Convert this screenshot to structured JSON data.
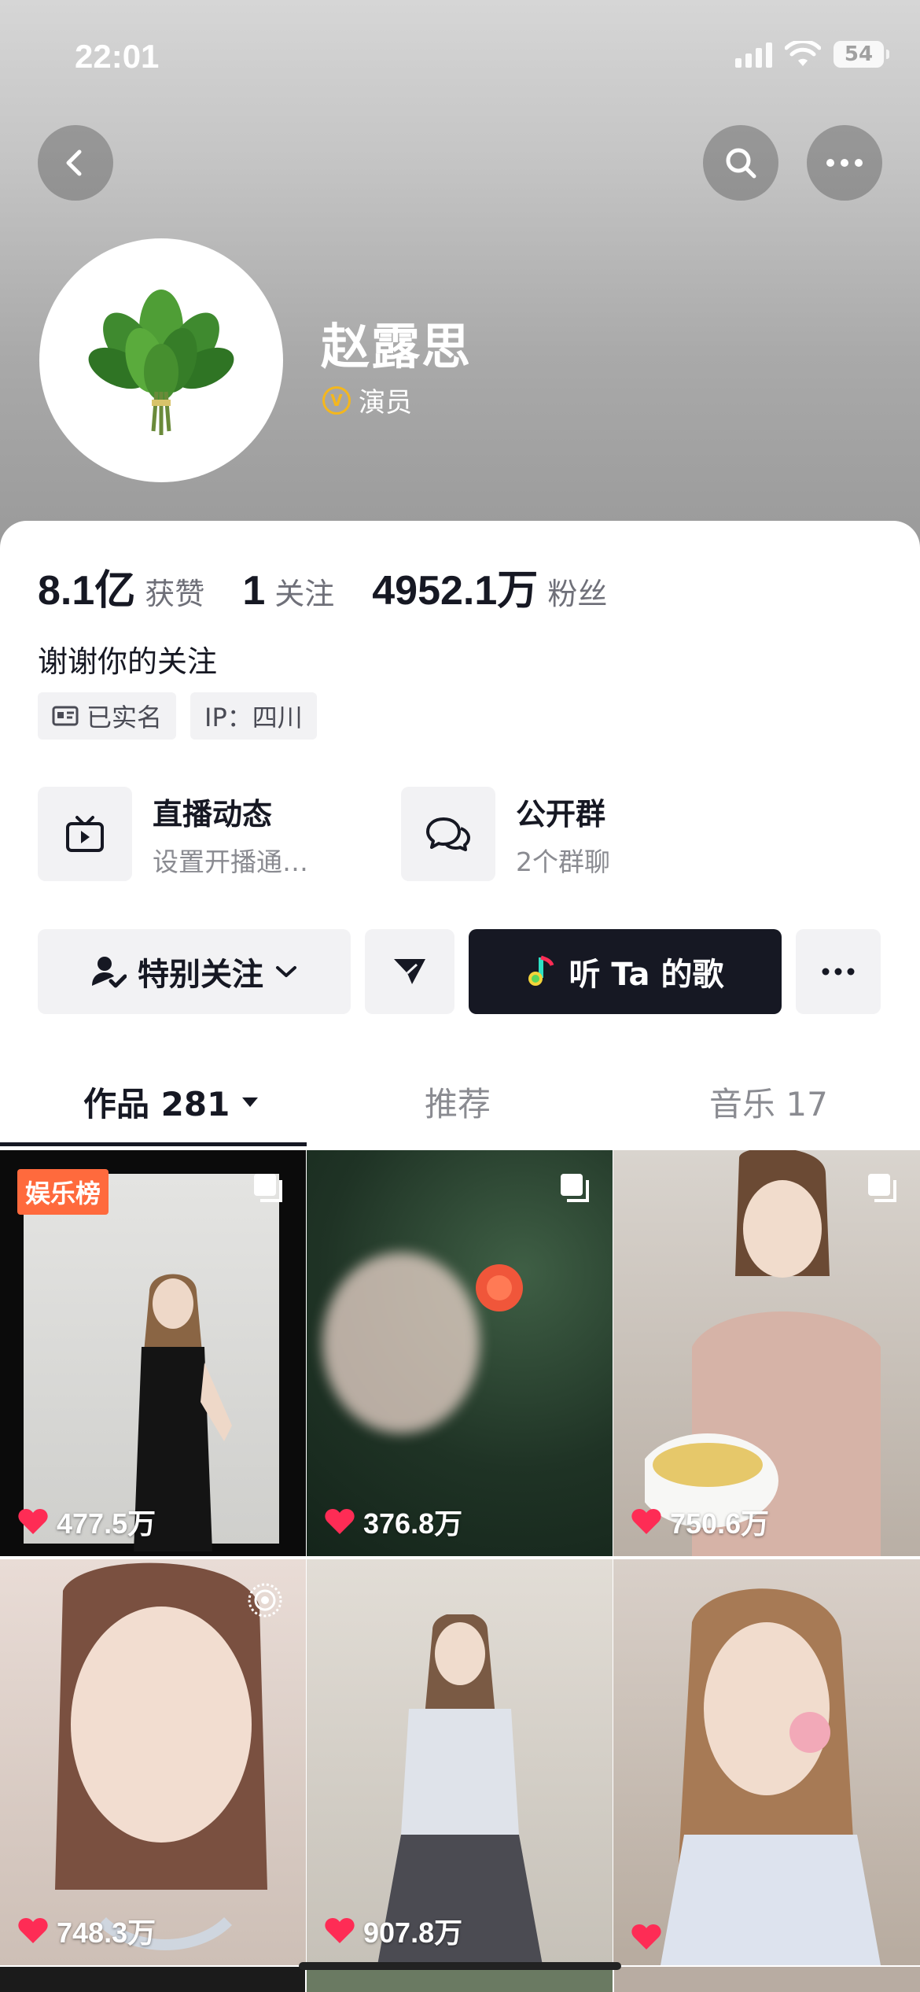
{
  "status_bar": {
    "time": "22:01",
    "battery": "54"
  },
  "profile": {
    "name": "赵露思",
    "verify_badge": "V",
    "verify_title": "演员",
    "bio": "谢谢你的关注"
  },
  "stats": [
    {
      "num": "8.1亿",
      "label": "获赞"
    },
    {
      "num": "1",
      "label": "关注"
    },
    {
      "num": "4952.1万",
      "label": "粉丝"
    }
  ],
  "tags": {
    "realname": "已实名",
    "ip": "IP：四川"
  },
  "features": {
    "live": {
      "title": "直播动态",
      "sub": "设置开播通…"
    },
    "group": {
      "title": "公开群",
      "sub": "2个群聊"
    }
  },
  "actions": {
    "follow": "特别关注",
    "music": "听 Ta 的歌"
  },
  "tabs": {
    "works": "作品 281",
    "recommend": "推荐",
    "music": "音乐 17"
  },
  "grid": [
    {
      "likes": "477.5万",
      "badge": "娱乐榜"
    },
    {
      "likes": "376.8万"
    },
    {
      "likes": "750.6万"
    },
    {
      "likes": "748.3万"
    },
    {
      "likes": "907.8万"
    },
    {
      "likes": ""
    }
  ],
  "colors": {
    "accent_like": "#fe2c55",
    "badge_orange": "#ff6a3d",
    "dark_button": "#161823",
    "verify_gold": "#f4b71d"
  }
}
